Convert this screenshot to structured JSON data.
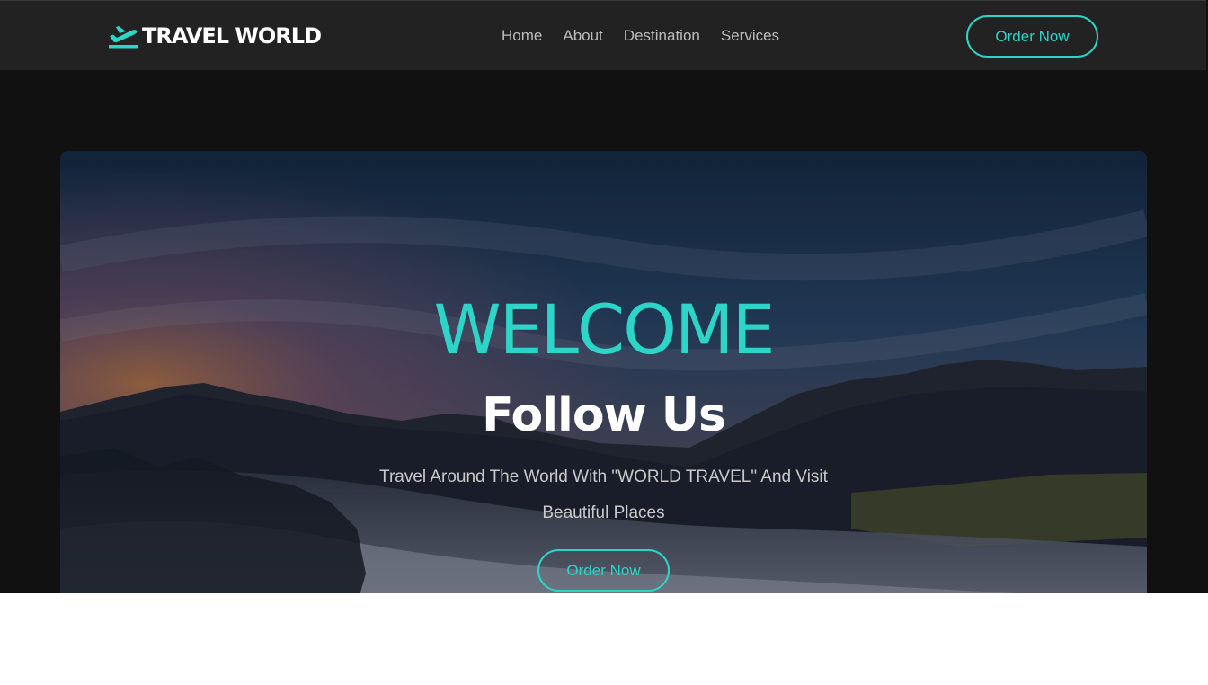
{
  "navbar": {
    "brand": "TRAVEL WORLD",
    "brand_icon": "plane-departure-icon",
    "links": [
      "Home",
      "About",
      "Destination",
      "Services"
    ],
    "order_button": "Order Now"
  },
  "hero": {
    "welcome": "WELCOME",
    "subtitle": "Follow Us",
    "description": "Travel Around The World With \"WORLD TRAVEL\" And Visit Beautiful Places",
    "order_button": "Order Now"
  },
  "colors": {
    "accent": "#2dd4c8",
    "navbar_bg": "#222222",
    "page_bg": "#111111"
  }
}
